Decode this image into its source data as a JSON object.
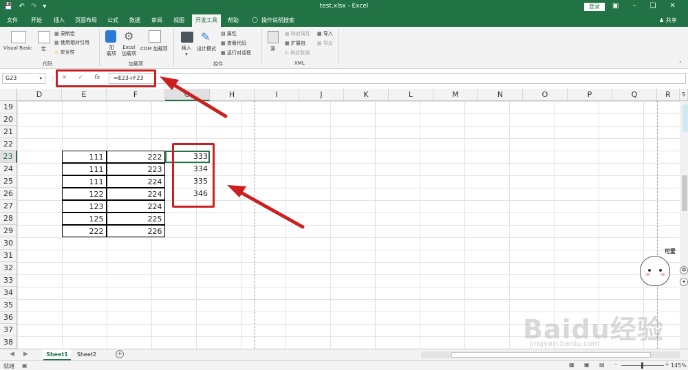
{
  "window": {
    "title": "test.xlsx - Excel",
    "login": "登录",
    "share": "共享",
    "search_hint": "操作说明搜索"
  },
  "tabs": [
    "文件",
    "开始",
    "插入",
    "页面布局",
    "公式",
    "数据",
    "审阅",
    "视图",
    "开发工具",
    "帮助"
  ],
  "active_tab": "开发工具",
  "ribbon": {
    "code": {
      "vb": "Visual Basic",
      "macro": "宏",
      "record": "录制宏",
      "relative": "使用相对引用",
      "security": "安全性",
      "label": "代码"
    },
    "addins": {
      "addins": "加载项",
      "excel_addins": "Excel 加载项",
      "com": "COM 加载项",
      "label": "加载项"
    },
    "controls": {
      "insert": "插入",
      "design": "设计模式",
      "properties": "属性",
      "view_code": "查看代码",
      "dialog": "运行对话框",
      "label": "控件"
    },
    "xml": {
      "source": "源",
      "map_props": "映射属性",
      "expansion": "扩展包",
      "refresh": "刷新数据",
      "import": "导入",
      "export": "导出",
      "label": "XML"
    }
  },
  "formula_bar": {
    "name_box": "G23",
    "formula": "=E23+F23",
    "cancel": "✕",
    "enter": "✓",
    "fx": "fx"
  },
  "columns": [
    "D",
    "E",
    "F",
    "G",
    "H",
    "I",
    "J",
    "K",
    "L",
    "M",
    "N",
    "O",
    "P",
    "Q",
    "R",
    "S"
  ],
  "rows": [
    19,
    20,
    21,
    22,
    23,
    24,
    25,
    26,
    27,
    28,
    29,
    30,
    31,
    32,
    33,
    34,
    35,
    36,
    37,
    38
  ],
  "cells": {
    "E": [
      111,
      111,
      111,
      122,
      123,
      125,
      222
    ],
    "F": [
      222,
      223,
      224,
      224,
      224,
      225,
      226
    ],
    "G": [
      333,
      334,
      335,
      346
    ]
  },
  "sheets": [
    "Sheet1",
    "Sheet2"
  ],
  "active_sheet": "Sheet1",
  "status": {
    "ready": "就绪",
    "zoom": "145%"
  },
  "overlay": {
    "sticker_text": "可爱",
    "side_btn1": "中",
    "watermark_main": "Baidu经验",
    "watermark_url": "jingyan.baidu.com"
  },
  "colors": {
    "brand": "#217346",
    "arrow": "#cc1f1f"
  }
}
